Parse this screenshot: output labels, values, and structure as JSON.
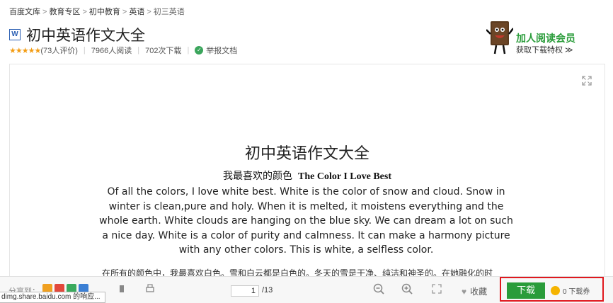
{
  "breadcrumb": [
    "百度文库",
    "教育专区",
    "初中教育",
    "英语",
    "初三英语"
  ],
  "breadcrumb_sep": ">",
  "doc": {
    "badge": "W",
    "title": "初中英语作文大全",
    "stars": "★★★★★",
    "rating": "(73人评价)",
    "reads": "7966人阅读",
    "downloads": "702次下载",
    "report": "举报文档"
  },
  "vip": {
    "join": "加人阅读会员",
    "privilege": "获取下载特权 ≫"
  },
  "page": {
    "heading": "初中英语作文大全",
    "subtitle_cn": "我最喜欢的颜色",
    "subtitle_en": "The Color I Love Best",
    "body": "Of all the colors,  I love white best. White is the color of snow and cloud. Snow in winter is clean,pure and holy. When it is melted, it moistens everything and the whole earth. White clouds are hanging on the blue sky. We can dream a lot on such a nice day. White is a color of purity and calmness. It can make a harmony picture with any other colors. This is white, a selfless color.",
    "cn_line": "在所有的颜色中，我最喜欢白色。雪和白云都是白色的。冬天的雪是干净、纯洁和神圣的。在她融化的时"
  },
  "toolbar": {
    "share": "分享到：",
    "page_current": "1",
    "page_total": "/13",
    "favorite": "收藏",
    "download": "下载",
    "coupon": "0 下载券"
  },
  "status": "dimg.share.baidu.com 的响应...",
  "colors": {
    "accent_green": "#2a9c3a",
    "highlight_red": "#e0181e",
    "star_orange": "#f39c12"
  }
}
